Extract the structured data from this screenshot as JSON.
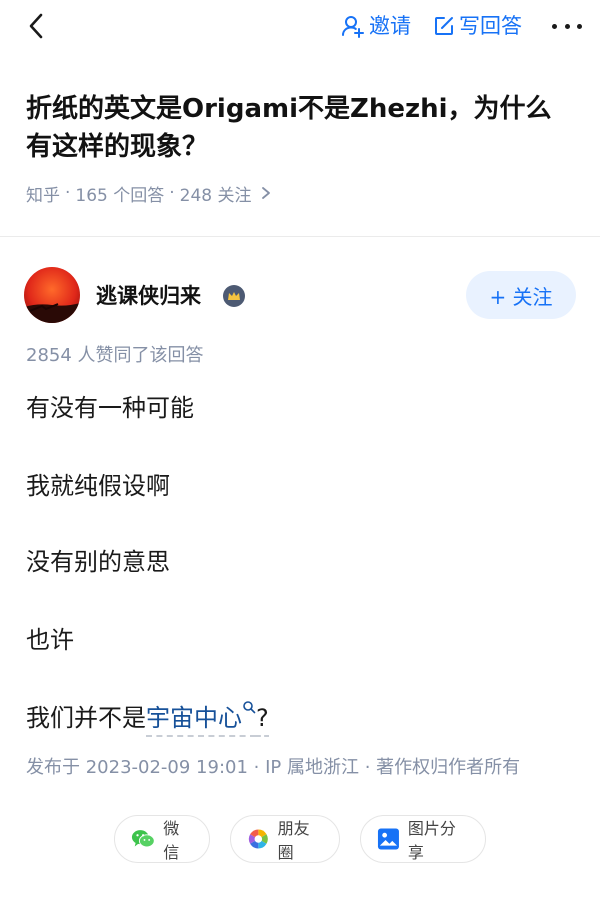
{
  "header": {
    "invite_label": "邀请",
    "write_answer_label": "写回答"
  },
  "question": {
    "title": "折纸的英文是Origami不是Zhezhi，为什么有这样的现象？",
    "source": "知乎",
    "answers_count": "165 个回答",
    "followers_count": "248 关注"
  },
  "author": {
    "name": "逃课侠归来",
    "follow_label": "+ 关注"
  },
  "answer": {
    "votes": "2854 人赞同了该回答",
    "lines": [
      "有没有一种可能",
      "我就纯假设啊",
      "没有别的意思",
      "也许"
    ],
    "last_line_prefix": "我们并不是",
    "last_line_keyword": "宇宙中心",
    "last_line_suffix": "?",
    "meta": "发布于 2023-02-09 19:01 · IP 属地浙江 · 著作权归作者所有"
  },
  "share": {
    "wechat": "微信",
    "moments": "朋友圈",
    "image": "图片分享"
  },
  "colors": {
    "accent": "#1772f6",
    "meta_gray": "#8590a6",
    "keyword_blue": "#175199"
  },
  "icons": [
    "back-icon",
    "invite-icon",
    "edit-icon",
    "more-icon",
    "crown-badge-icon",
    "search-icon",
    "wechat-icon",
    "moments-icon",
    "image-icon"
  ]
}
